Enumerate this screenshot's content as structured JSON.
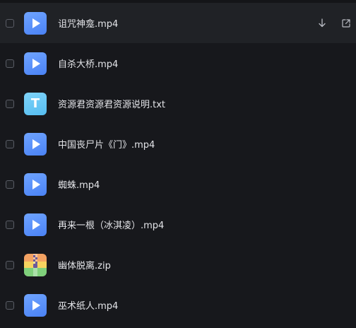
{
  "files": [
    {
      "name": "诅咒神龛.mp4",
      "type": "video"
    },
    {
      "name": "自杀大桥.mp4",
      "type": "video"
    },
    {
      "name": "资源君资源君资源说明.txt",
      "type": "text",
      "icon_letter": "T"
    },
    {
      "name": "中国丧尸片《门》.mp4",
      "type": "video"
    },
    {
      "name": "蜘蛛.mp4",
      "type": "video"
    },
    {
      "name": "再来一根（冰淇凌）.mp4",
      "type": "video"
    },
    {
      "name": "幽体脱离.zip",
      "type": "zip"
    },
    {
      "name": "巫术纸人.mp4",
      "type": "video"
    }
  ],
  "hovered_row_actions": [
    "download-icon",
    "share-icon"
  ],
  "colors": {
    "background": "#17181c",
    "hover_row": "#202226",
    "text": "#e3e4e8",
    "video_icon": "#5b8ff9",
    "text_icon": "#6ccaf6"
  }
}
